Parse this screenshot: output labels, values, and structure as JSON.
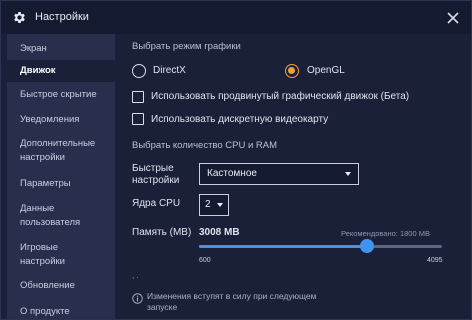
{
  "window": {
    "title": "Настройки"
  },
  "sidebar": {
    "items": [
      {
        "label": "Экран"
      },
      {
        "label": "Движок",
        "active": true
      },
      {
        "label": "Быстрое скрытие"
      },
      {
        "label": "Уведомления"
      },
      {
        "label_line1": "Дополнительные",
        "label_line2": "настройки"
      },
      {
        "label": "Параметры"
      },
      {
        "label_line1": "Данные",
        "label_line2": "пользователя"
      },
      {
        "label_line1": "Игровые",
        "label_line2": "настройки"
      },
      {
        "label": "Обновление"
      },
      {
        "label": "О продукте"
      }
    ]
  },
  "graphics": {
    "section_title": "Выбрать режим графики",
    "options": [
      {
        "label": "DirectX",
        "selected": false
      },
      {
        "label": "OpenGL",
        "selected": true
      }
    ],
    "advanced_engine_label": "Использовать продвинутый графический движок (Бета)",
    "advanced_engine_checked": false,
    "discrete_gpu_label": "Использовать дискретную видеокарту",
    "discrete_gpu_checked": false
  },
  "resources": {
    "section_title": "Выбрать количество CPU и RAM",
    "quick_settings_label_line1": "Быстрые",
    "quick_settings_label_line2": "настройки",
    "quick_settings_value": "Кастомное",
    "cpu_label": "Ядра CPU",
    "cpu_value": "2",
    "memory_label": "Память (MB)",
    "memory_value": "3008 MB",
    "recommended": "Рекомендовано: 1800 MB",
    "memory_min": "600",
    "memory_max": "4095",
    "memory_fraction": 0.69,
    "next_section_stub": ", ."
  },
  "notice": {
    "text_line1": "Изменения вступят в силу при следующем",
    "text_line2": "запуске"
  },
  "colors": {
    "accent": "#3f94ee",
    "radio_selected": "#f0a030",
    "background": "#1a2038",
    "sidebar": "#272f4c"
  }
}
